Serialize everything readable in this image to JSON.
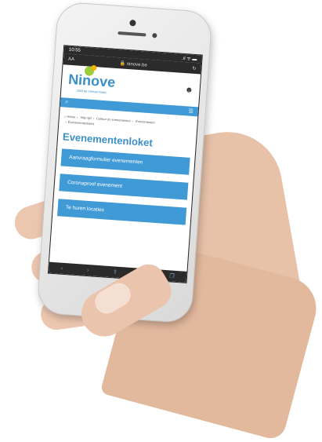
{
  "status": {
    "time": "10:55",
    "signal": ".ıl ᯤ ▬"
  },
  "browser": {
    "text_size": "AA",
    "lock": "🔒",
    "url": "ninove.be",
    "reload": "↻"
  },
  "site": {
    "logo_text": "Ninove",
    "tagline": "stad op mensenmaat",
    "user_icon": "user-icon",
    "search_icon": "⌕",
    "menu_icon": "☰"
  },
  "breadcrumb": {
    "items": [
      "Home",
      "Vrije tijd",
      "Cultuur en evenementen",
      "Evenementen",
      "Evenementenloket"
    ]
  },
  "page": {
    "title": "Evenementenloket",
    "buttons": [
      "Aanvraagformulier evenementen",
      "Coronaproof evenement",
      "Te huren locaties"
    ]
  },
  "toolbar": {
    "back": "‹",
    "forward": "›",
    "share": "⇪",
    "bookmarks": "⧉",
    "tabs": "❐"
  }
}
